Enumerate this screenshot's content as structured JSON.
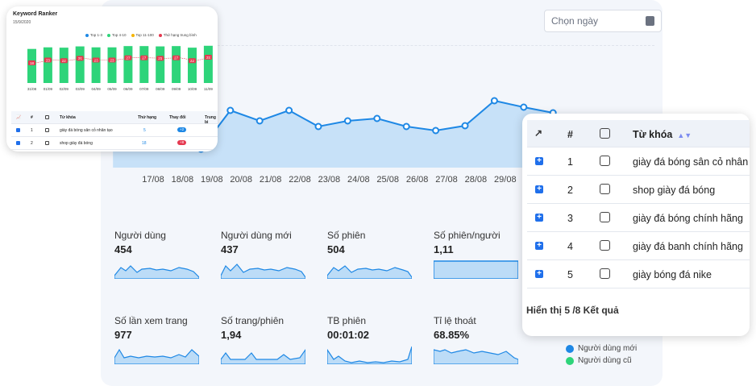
{
  "date_picker": {
    "placeholder": "Chọn ngày",
    "icon": "calendar-icon"
  },
  "main_chart": {
    "x_labels": [
      "17/08",
      "18/08",
      "19/08",
      "20/08",
      "21/08",
      "22/08",
      "23/08",
      "24/08",
      "25/08",
      "26/08",
      "27/08",
      "28/08",
      "29/08"
    ],
    "series_color": "#1e88e5",
    "fill_color": "#bcdcf7"
  },
  "metrics": [
    {
      "label": "Người dùng",
      "value": "454"
    },
    {
      "label": "Người dùng mới",
      "value": "437"
    },
    {
      "label": "Số phiên",
      "value": "504"
    },
    {
      "label": "Số phiên/người",
      "value": "1,11"
    },
    {
      "label": "Số lần xem trang",
      "value": "977"
    },
    {
      "label": "Số trang/phiên",
      "value": "1,94"
    },
    {
      "label": "TB phiên",
      "value": "00:01:02"
    },
    {
      "label": "Tỉ lệ thoát",
      "value": "68.85%"
    }
  ],
  "pie_legend": [
    {
      "label": "Người dùng mới",
      "color": "#1e88e5"
    },
    {
      "label": "Người dùng cũ",
      "color": "#2ed47a"
    }
  ],
  "keyword_ranker": {
    "title": "Keyword Ranker",
    "date": "15/9/2020",
    "legend": [
      {
        "label": "Top 1-3",
        "color": "#1e88e5"
      },
      {
        "label": "Top 4-10",
        "color": "#2ed47a"
      },
      {
        "label": "Top 11-100",
        "color": "#f5b400"
      },
      {
        "label": "Thứ hạng trung bình",
        "color": "#e53950"
      }
    ],
    "chart_data": {
      "type": "bar",
      "categories": [
        "31/08",
        "01/09",
        "02/09",
        "03/09",
        "04/09",
        "05/09",
        "06/09",
        "07/09",
        "08/09",
        "09/09",
        "10/09",
        "11/09"
      ],
      "values": [
        18,
        23,
        22,
        26,
        23,
        23,
        27,
        27,
        26,
        27,
        22,
        28
      ],
      "bar_color": "#2ed47a",
      "label_color": "#e53950"
    },
    "table": {
      "headers": [
        "#",
        "Từ khóa",
        "Thứ hạng",
        "Thay đổi",
        "Trung bì"
      ],
      "rows": [
        {
          "index": "1",
          "keyword": "giày đá bóng sân cỏ nhân tạo",
          "rank": "5",
          "change": "+2",
          "change_color": "#1e88e5"
        },
        {
          "index": "2",
          "keyword": "shop giày đá bóng",
          "rank": "18",
          "change": "+8",
          "change_color": "#e53950"
        }
      ]
    }
  },
  "keyword_table": {
    "headers": {
      "index": "#",
      "keyword": "Từ khóa"
    },
    "rows": [
      {
        "index": "1",
        "keyword": "giày đá bóng sân cỏ nhân tạo"
      },
      {
        "index": "2",
        "keyword": "shop giày đá bóng"
      },
      {
        "index": "3",
        "keyword": "giày đá bóng chính hãng"
      },
      {
        "index": "4",
        "keyword": "giày đá banh chính hãng"
      },
      {
        "index": "5",
        "keyword": "giày bóng đá nike"
      }
    ],
    "footer": "Hiển thị 5 /8 Kết quả"
  }
}
